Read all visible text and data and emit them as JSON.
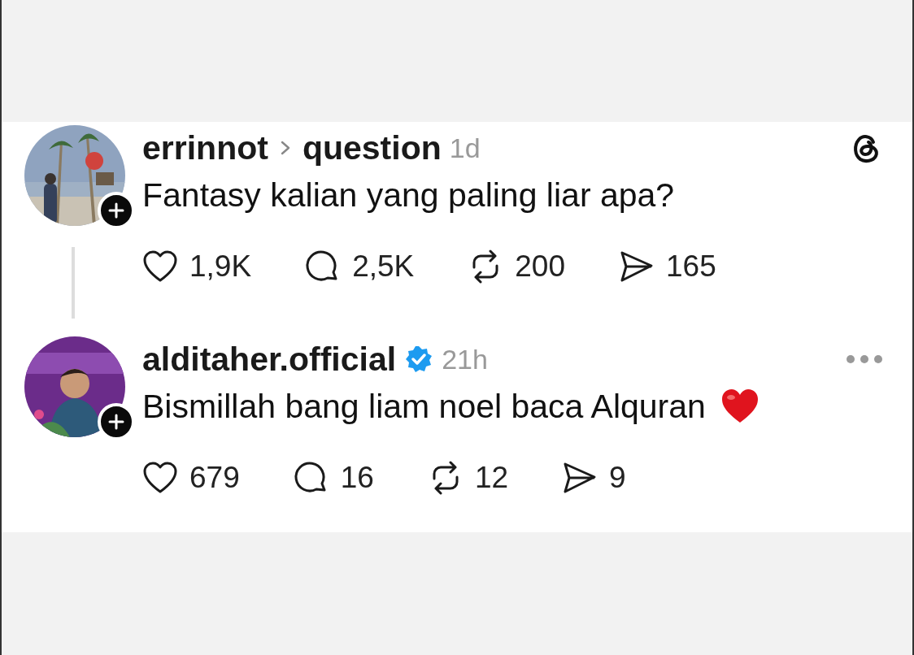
{
  "posts": [
    {
      "kind": "root",
      "username": "errinnot",
      "topic": "question",
      "verified": false,
      "time": "1d",
      "text": "Fantasy kalian yang paling liar apa?",
      "emoji": false,
      "thread_line": true,
      "stats": {
        "likes": "1,9K",
        "replies": "2,5K",
        "reposts": "200",
        "shares": "165"
      }
    },
    {
      "kind": "reply",
      "username": "alditaher.official",
      "verified": true,
      "time": "21h",
      "text": "Bismillah bang liam noel baca Alquran",
      "emoji": true,
      "thread_line": false,
      "stats": {
        "likes": "679",
        "replies": "16",
        "reposts": "12",
        "shares": "9"
      }
    }
  ]
}
